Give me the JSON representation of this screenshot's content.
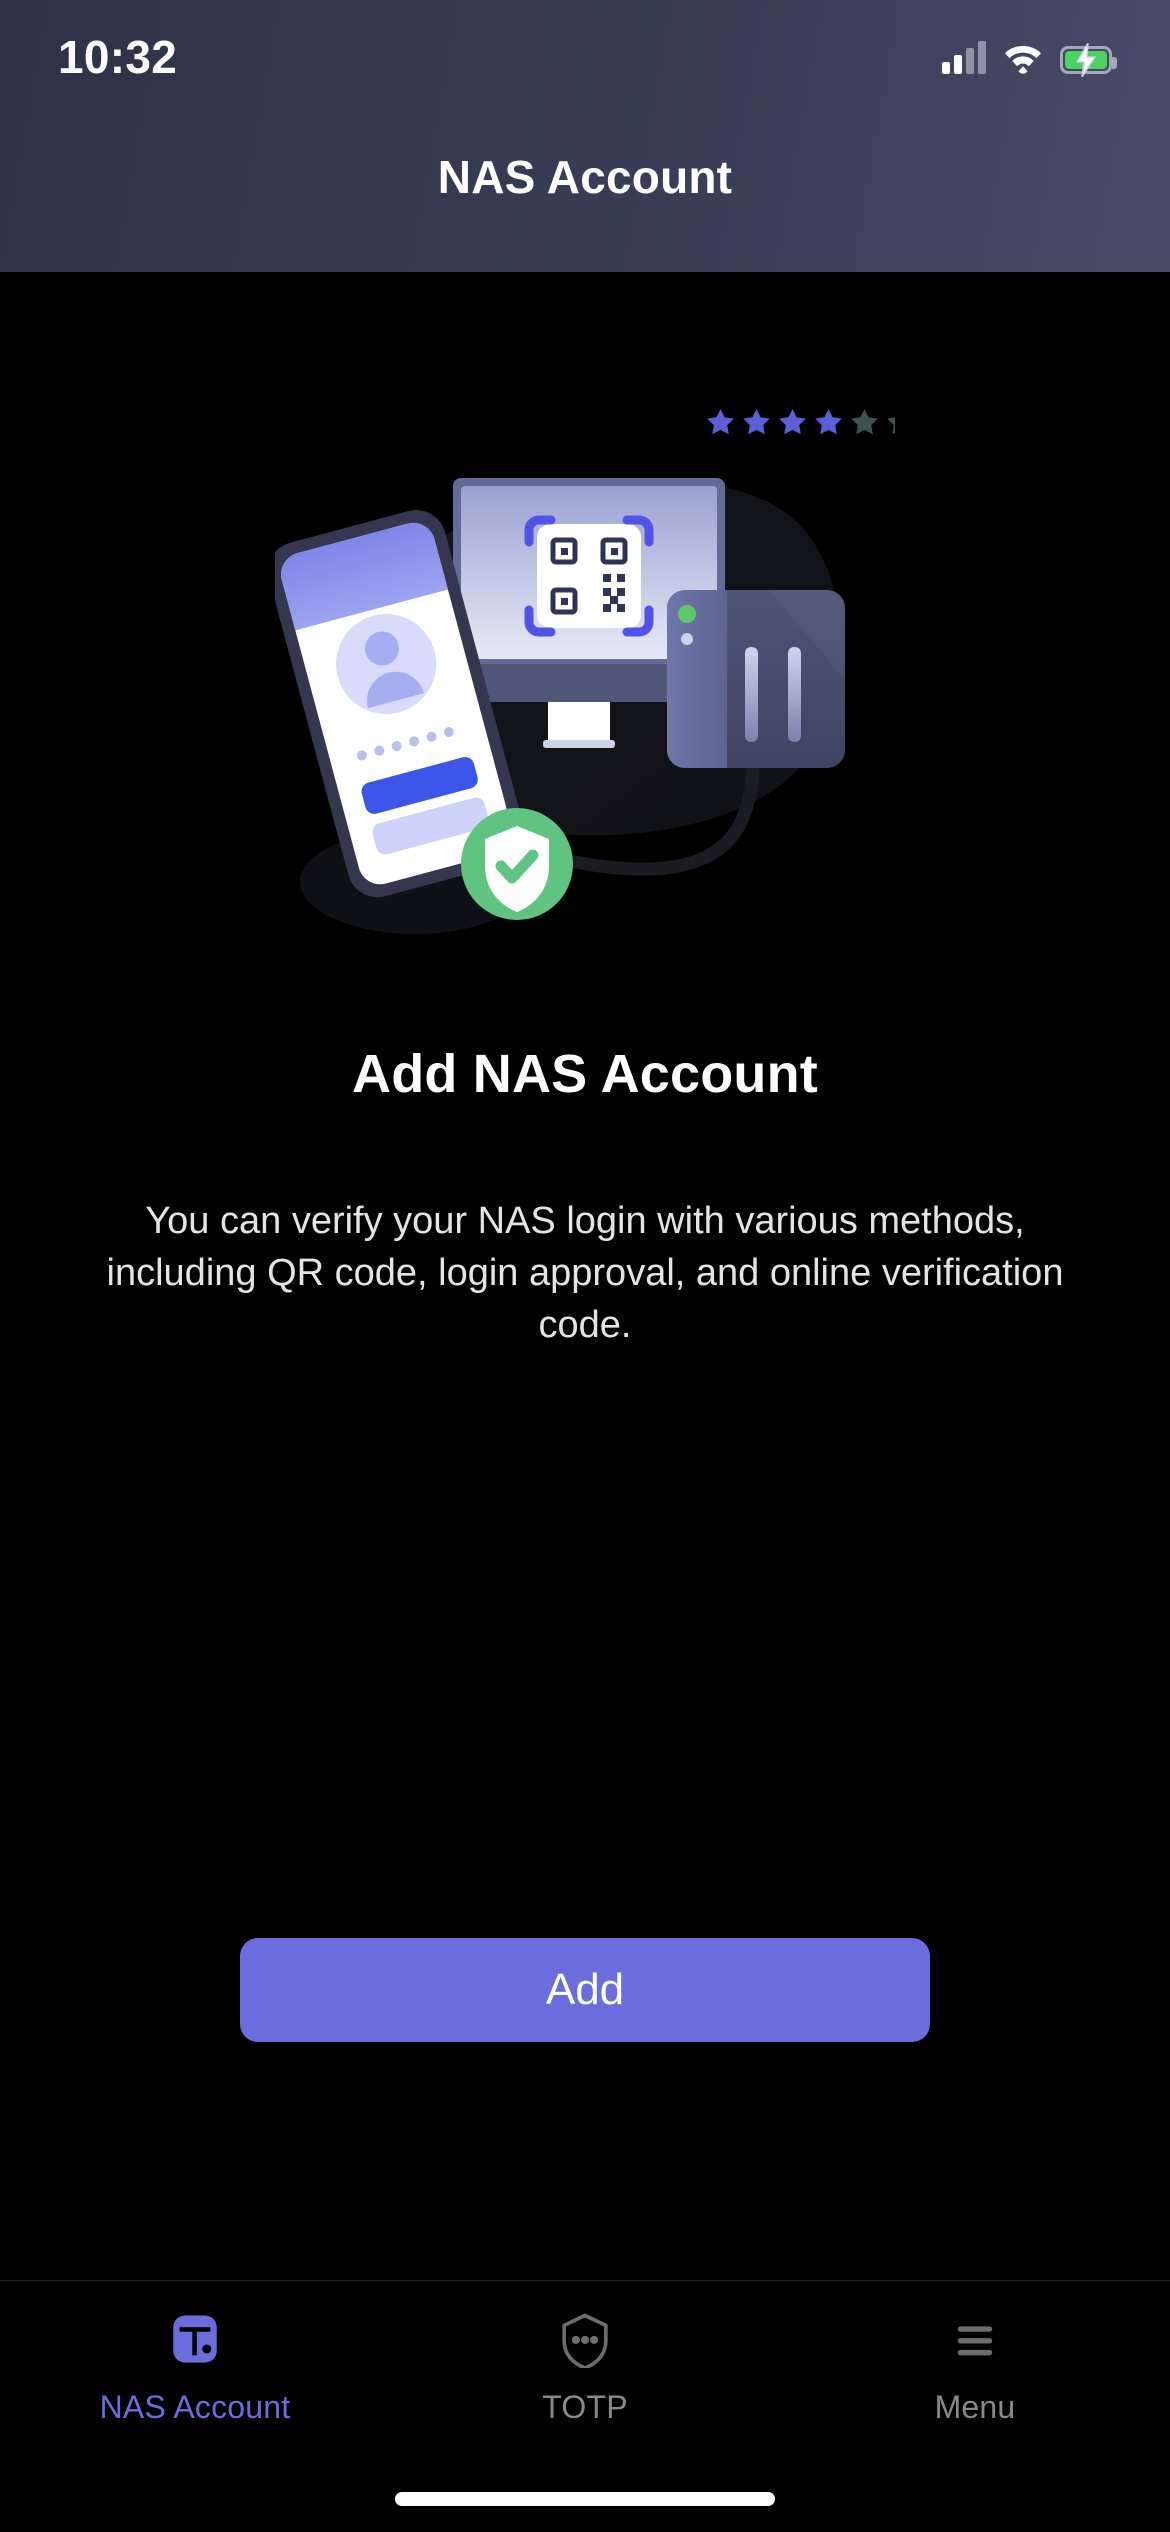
{
  "status_bar": {
    "time": "10:32",
    "signal_icon": "cellular-signal-icon",
    "signal_bars_filled": 2,
    "signal_bars_total": 4,
    "wifi_icon": "wifi-icon",
    "battery_icon": "battery-charging-icon",
    "battery_color": "#4ad45f"
  },
  "header": {
    "title": "NAS Account",
    "background_start": "#2e3248",
    "background_end": "#474b68"
  },
  "illustration": {
    "name": "nas-account-illustration",
    "stars": {
      "total": 6,
      "filled": 4,
      "filled_color": "#5b5fd8",
      "empty_color": "#3e5350"
    },
    "elements": [
      "phone-with-avatar",
      "monitor-with-qr-code",
      "nas-server-device",
      "green-shield-check"
    ],
    "accent_purple": "#4f53e8",
    "shield_green": "#5ec47f"
  },
  "main": {
    "title": "Add NAS Account",
    "description": "You can verify your NAS login with various methods, including QR code, login approval, and online verification code.",
    "primary_button": {
      "label": "Add",
      "color": "#6b6ddc",
      "text_color": "#ffffff"
    }
  },
  "tabbar": {
    "active_color": "#6b6ddc",
    "inactive_color": "#8a8a8e",
    "items": [
      {
        "label": "NAS Account",
        "icon": "nas-device-icon",
        "active": true
      },
      {
        "label": "TOTP",
        "icon": "shield-dots-icon",
        "active": false
      },
      {
        "label": "Menu",
        "icon": "hamburger-menu-icon",
        "active": false
      }
    ]
  },
  "home_indicator": {
    "name": "home-indicator",
    "color": "#ffffff"
  }
}
